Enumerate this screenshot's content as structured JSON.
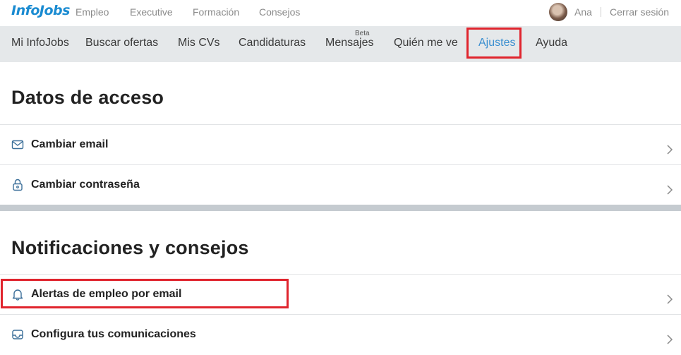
{
  "brand": {
    "logo_text": "InfoJobs"
  },
  "top_nav": [
    {
      "label": "Empleo"
    },
    {
      "label": "Executive"
    },
    {
      "label": "Formación"
    },
    {
      "label": "Consejos"
    }
  ],
  "user": {
    "name": "Ana",
    "logout_label": "Cerrar sesión"
  },
  "sub_nav": {
    "items": [
      {
        "label": "Mi InfoJobs"
      },
      {
        "label": "Buscar ofertas"
      },
      {
        "label": "Mis CVs"
      },
      {
        "label": "Candidaturas"
      },
      {
        "label": "Mensajes",
        "badge": "Beta"
      },
      {
        "label": "Quién me ve"
      },
      {
        "label": "Ajustes",
        "active": true
      },
      {
        "label": "Ayuda"
      }
    ]
  },
  "sections": [
    {
      "title": "Datos de acceso",
      "rows": [
        {
          "label": "Cambiar email",
          "icon": "envelope-icon"
        },
        {
          "label": "Cambiar contraseña",
          "icon": "lock-icon"
        }
      ]
    },
    {
      "title": "Notificaciones y consejos",
      "rows": [
        {
          "label": "Alertas de empleo por email",
          "icon": "bell-icon"
        },
        {
          "label": "Configura tus comunicaciones",
          "icon": "inbox-icon"
        }
      ]
    }
  ],
  "colors": {
    "brand_blue": "#1a8bd1",
    "active_link": "#3b8fd0",
    "subnav_bg": "#e5e8ea",
    "highlight_red": "#e0242d"
  }
}
